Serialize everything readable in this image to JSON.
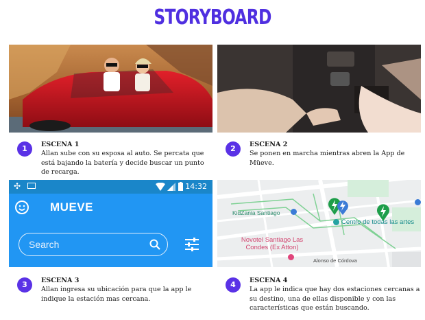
{
  "header": {
    "title": "STORYBOARD"
  },
  "scenes": [
    {
      "number": "1",
      "heading": "ESCENA 1",
      "text": "Allan sube con su esposa al auto. Se percata que está bajando la batería y decide buscar un punto de recarga."
    },
    {
      "number": "2",
      "heading": "ESCENA 2",
      "text": "Se ponen en marcha mientras abren la App de Müeve."
    },
    {
      "number": "3",
      "heading": "ESCENA 3",
      "text": "Allan ingresa su ubicación para que la app le indique la estación mas cercana."
    },
    {
      "number": "4",
      "heading": "ESCENA 4",
      "text": "La app le indica que hay dos estaciones cercanas a su destino, una de ellas disponible y con las características que están buscando."
    }
  ],
  "app": {
    "time": "14:32",
    "title": "MUEVE",
    "search_placeholder": "Search"
  },
  "map": {
    "labels": [
      "KidZania Santiago",
      "Centro de todas las artes",
      "Novotel Santiago Las Condes (Ex Atton)",
      "Alonso de Córdova"
    ]
  },
  "colors": {
    "title": "#4f2fe0",
    "badge": "#5a32e6",
    "app_bar": "#2196f3",
    "status_bar": "#1a86c9",
    "charger_green": "#1e9e4a"
  }
}
